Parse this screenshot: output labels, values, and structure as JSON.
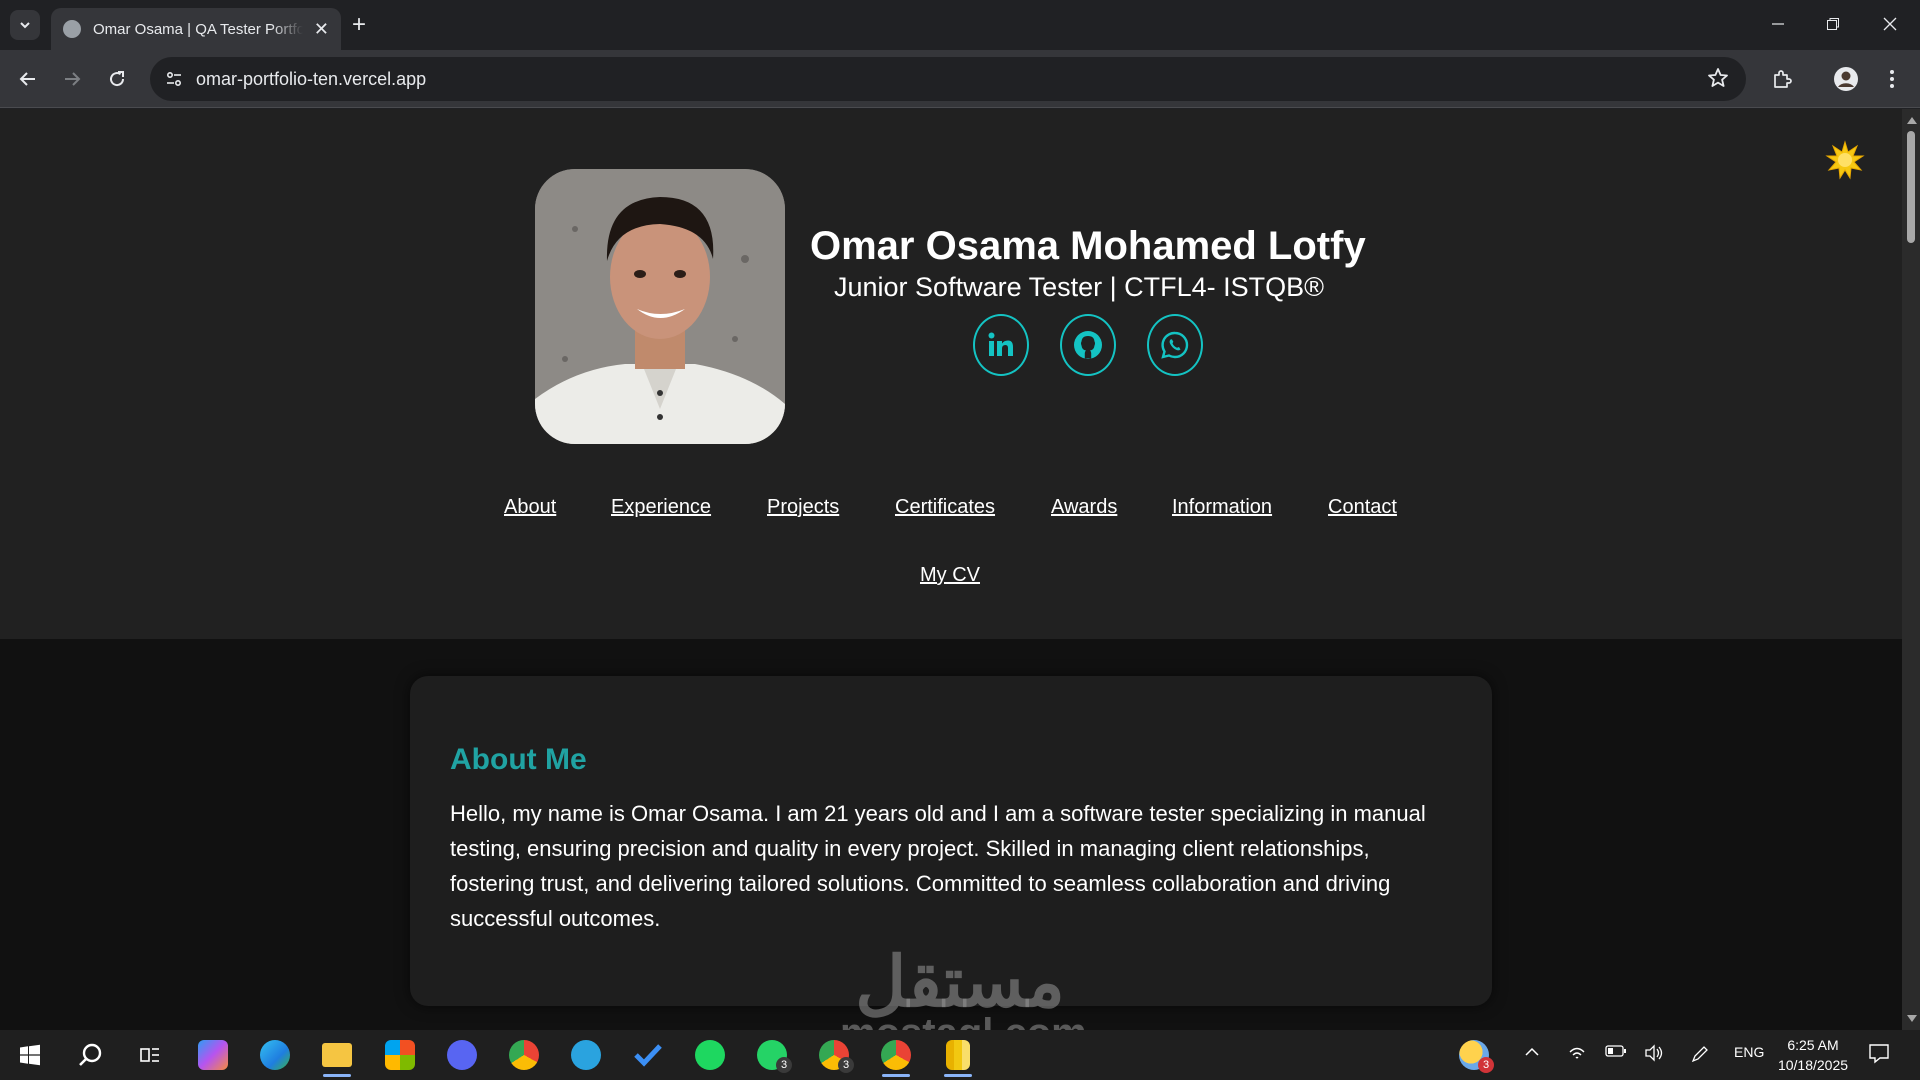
{
  "browser": {
    "tab_title": "Omar Osama | QA Tester Portfolio",
    "url": "omar-portfolio-ten.vercel.app"
  },
  "header": {
    "name": "Omar Osama Mohamed Lotfy",
    "subtitle": "Junior Software Tester | CTFL4- ISTQB®",
    "social_icons": [
      "linkedin-icon",
      "github-icon",
      "whatsapp-icon"
    ],
    "theme_toggle_icon": "sun-icon"
  },
  "nav": {
    "about": "About",
    "experience": "Experience",
    "projects": "Projects",
    "certificates": "Certificates",
    "awards": "Awards",
    "information": "Information",
    "contact": "Contact",
    "cv": "My CV"
  },
  "about": {
    "title": "About Me",
    "text": "Hello, my name is Omar Osama. I am 21 years old and I am a software tester specializing in manual testing, ensuring precision and quality in every project. Skilled in managing client relationships, fostering trust, and delivering tailored solutions. Committed to seamless collaboration and driving successful outcomes."
  },
  "watermark": {
    "arabic": "مستقل",
    "latin": "mostaql.com"
  },
  "taskbar": {
    "whatsapp_badge": "3",
    "chrome_badge": "3",
    "weather_badge": "3",
    "language": "ENG",
    "time": "6:25 AM",
    "date": "10/18/2025"
  },
  "colors": {
    "accent": "#20a3a3",
    "social_ring": "#14c3c3",
    "header_bg": "#212121",
    "page_bg": "#111111"
  }
}
